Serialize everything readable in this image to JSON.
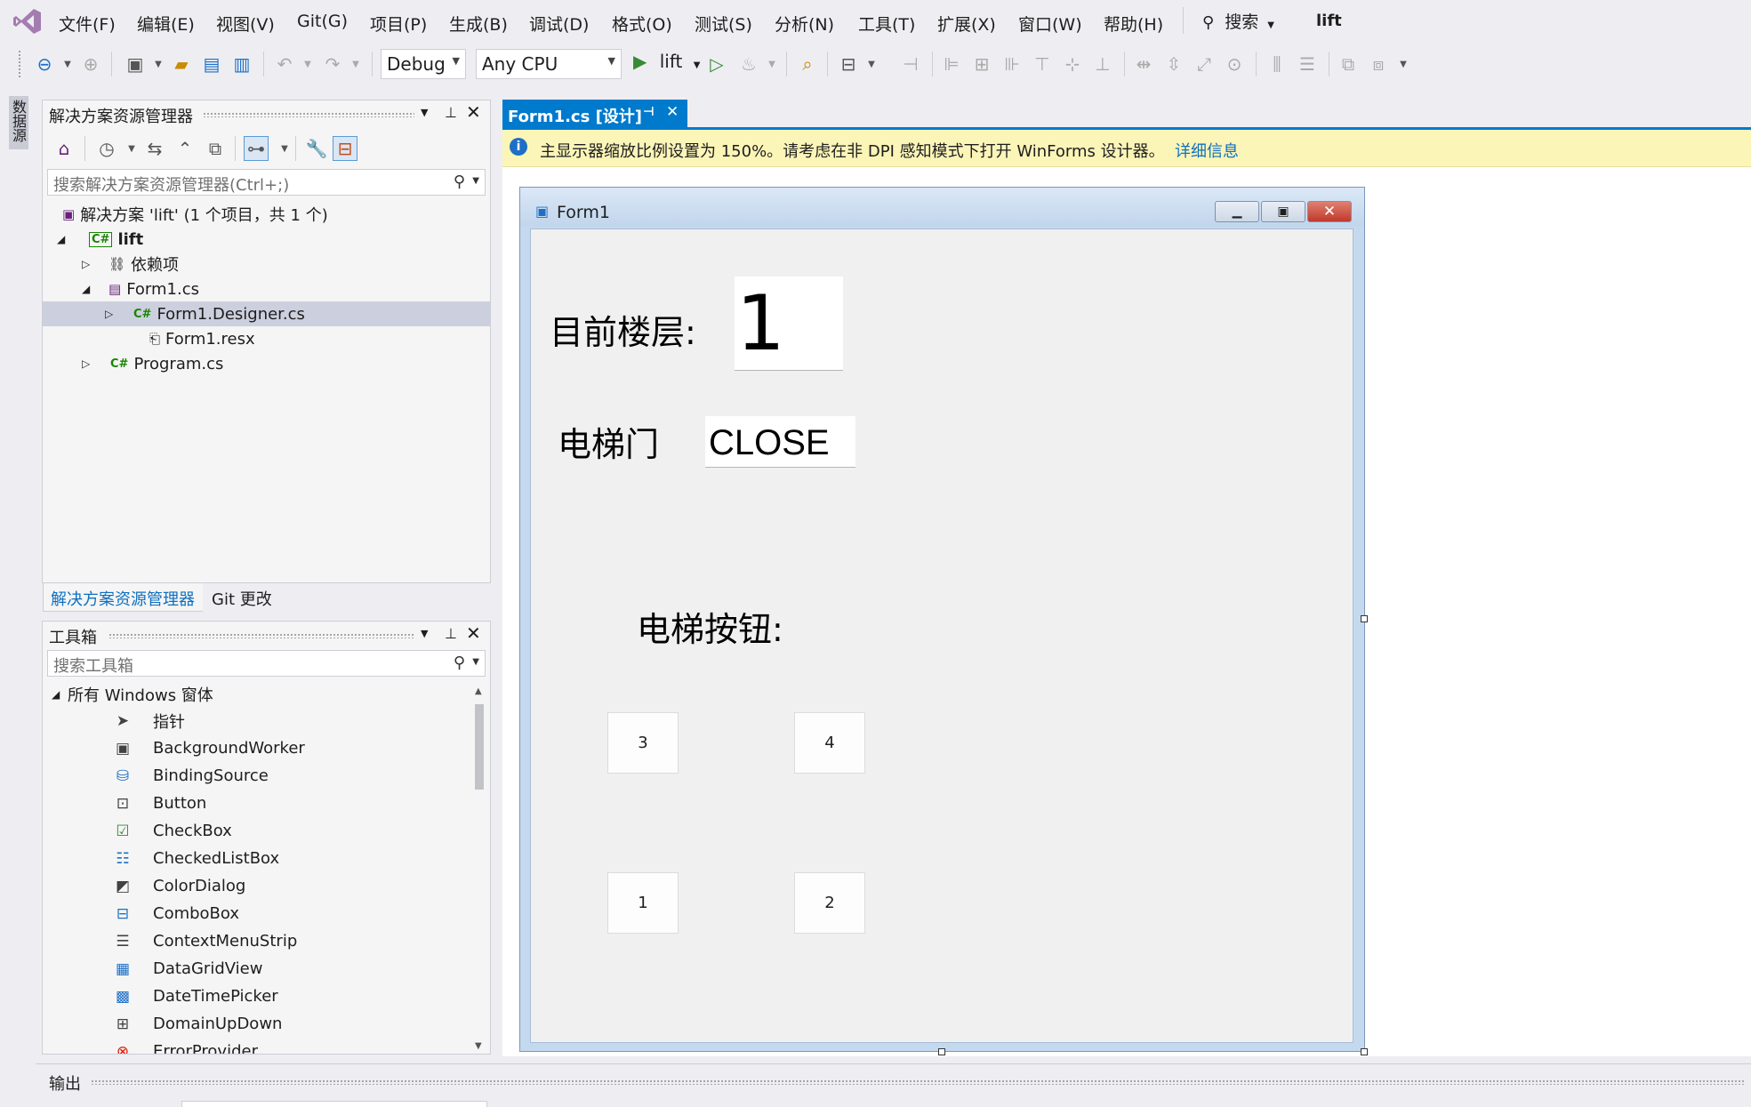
{
  "menu": {
    "items": [
      "文件(F)",
      "编辑(E)",
      "视图(V)",
      "Git(G)",
      "项目(P)",
      "生成(B)",
      "调试(D)",
      "格式(O)",
      "测试(S)",
      "分析(N)",
      "工具(T)",
      "扩展(X)",
      "窗口(W)",
      "帮助(H)"
    ],
    "search_label": "搜索",
    "app_title": "lift"
  },
  "toolbar": {
    "config": "Debug",
    "platform": "Any CPU",
    "run_label": "lift"
  },
  "side_strip": {
    "tab_label": "数据源"
  },
  "solution_explorer": {
    "title": "解决方案资源管理器",
    "search_placeholder": "搜索解决方案资源管理器(Ctrl+;)",
    "tree": [
      {
        "label": "解决方案 'lift' (1 个项目，共 1 个)"
      },
      {
        "label": "lift"
      },
      {
        "label": "依赖项"
      },
      {
        "label": "Form1.cs"
      },
      {
        "label": "Form1.Designer.cs"
      },
      {
        "label": "Form1.resx"
      },
      {
        "label": "Program.cs"
      }
    ],
    "tabs": [
      "解决方案资源管理器",
      "Git 更改"
    ]
  },
  "toolbox": {
    "title": "工具箱",
    "search_placeholder": "搜索工具箱",
    "group": "所有 Windows 窗体",
    "items": [
      "指针",
      "BackgroundWorker",
      "BindingSource",
      "Button",
      "CheckBox",
      "CheckedListBox",
      "ColorDialog",
      "ComboBox",
      "ContextMenuStrip",
      "DataGridView",
      "DateTimePicker",
      "DomainUpDown",
      "ErrorProvider"
    ]
  },
  "document": {
    "tab_label": "Form1.cs [设计]",
    "info_text": "主显示器缩放比例设置为 150%。请考虑在非 DPI 感知模式下打开 WinForms 设计器。",
    "info_link": "详细信息"
  },
  "form": {
    "title": "Form1",
    "floor_label": "目前楼层:",
    "floor_value": "1",
    "door_label": "电梯门",
    "door_value": "CLOSE",
    "buttons_label": "电梯按钮:",
    "buttons": [
      "3",
      "4",
      "1",
      "2"
    ]
  },
  "output": {
    "title": "输出"
  },
  "colors": {
    "accent": "#007acc",
    "info_bar": "#fcf5b8",
    "selection": "#ccd0de"
  }
}
